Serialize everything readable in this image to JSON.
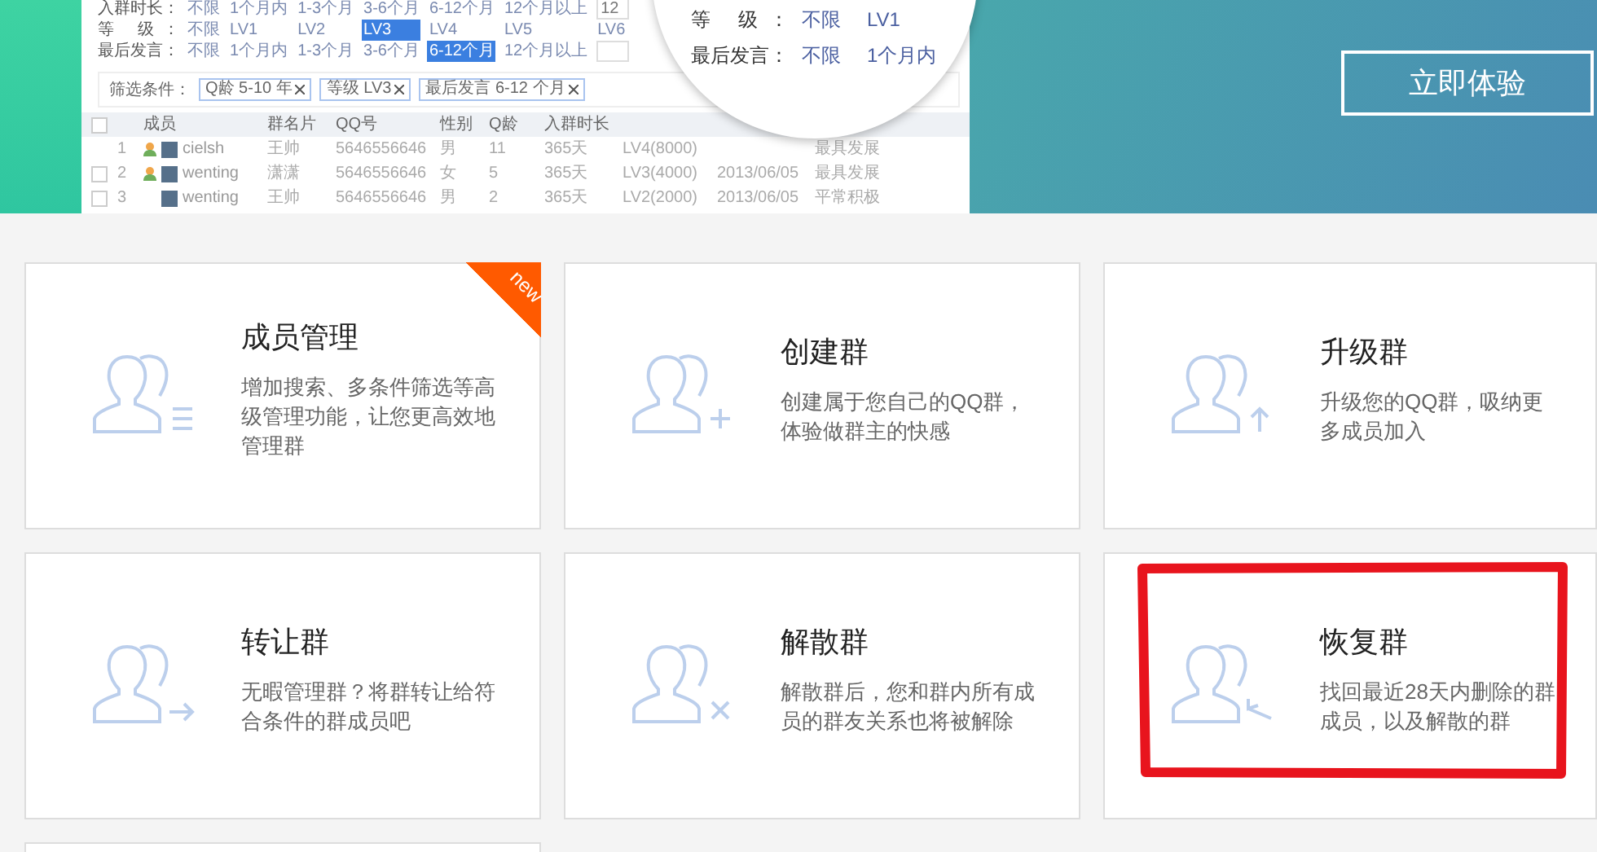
{
  "banner": {
    "preview": {
      "filters": [
        {
          "label": "入群时长：",
          "options": [
            {
              "text": "不限",
              "selected": false
            },
            {
              "text": "1个月内",
              "selected": false
            },
            {
              "text": "1-3个月",
              "selected": false
            },
            {
              "text": "3-6个月",
              "selected": false
            },
            {
              "text": "6-12个月",
              "selected": false
            },
            {
              "text": "12个月以上",
              "selected": false
            }
          ],
          "input_box": true,
          "input": "12"
        },
        {
          "label": "等 级：",
          "options": [
            {
              "text": "不限",
              "selected": false
            },
            {
              "text": "LV1",
              "selected": false
            },
            {
              "text": "LV2",
              "selected": false
            },
            {
              "text": "LV3",
              "selected": true
            },
            {
              "text": "LV4",
              "selected": false
            },
            {
              "text": "LV5",
              "selected": false
            },
            {
              "text": "LV6",
              "selected": false
            }
          ],
          "input_box": false
        },
        {
          "label": "最后发言：",
          "options": [
            {
              "text": "不限",
              "selected": false
            },
            {
              "text": "1个月内",
              "selected": false
            },
            {
              "text": "1-3个月",
              "selected": false
            },
            {
              "text": "3-6个月",
              "selected": false
            },
            {
              "text": "6-12个月",
              "selected": true
            },
            {
              "text": "12个月以上",
              "selected": false
            }
          ],
          "input_box": true
        }
      ],
      "conditions": {
        "label": "筛选条件：",
        "tags": [
          "Q龄 5-10 年",
          "等级 LV3",
          "最后发言 6-12 个月"
        ]
      },
      "table": {
        "all_checked": false,
        "columns": [
          "成员",
          "群名片",
          "QQ号",
          "性别",
          "Q龄",
          "入群时长"
        ],
        "rows": [
          {
            "index": "1",
            "admin": true,
            "name": "cielsh",
            "card": "王帅",
            "qq": "5646556646",
            "gender": "男",
            "age": "11",
            "duration": "365天",
            "level": "LV4(8000)",
            "activity": "最具发展"
          },
          {
            "checked": false,
            "index": "2",
            "admin": true,
            "name": "wenting",
            "card": "潇潇",
            "qq": "5646556646",
            "gender": "女",
            "age": "5",
            "duration": "365天",
            "level": "LV3(4000)",
            "date": "2013/06/05",
            "activity": "最具发展"
          },
          {
            "checked": false,
            "index": "3",
            "admin": false,
            "name": "wenting",
            "card": "王帅",
            "qq": "5646556646",
            "gender": "男",
            "age": "2",
            "duration": "365天",
            "level": "LV2(2000)",
            "date": "2013/06/05",
            "activity": "平常积极"
          }
        ]
      }
    },
    "magnifier": [
      {
        "label": "等 级：",
        "values": [
          "不限",
          "LV1"
        ]
      },
      {
        "label": "最后发言：",
        "values": [
          "不限",
          "1个月内"
        ]
      }
    ],
    "cta": "立即体验"
  },
  "cards": [
    {
      "title": "成员管理",
      "description": "增加搜索、多条件筛选等高级管理功能，让您更高效地管理群",
      "badge": "new",
      "highlighted": false
    },
    {
      "title": "创建群",
      "description": "创建属于您自己的QQ群，体验做群主的快感",
      "highlighted": false
    },
    {
      "title": "升级群",
      "description": "升级您的QQ群，吸纳更多成员加入",
      "highlighted": false
    },
    {
      "title": "转让群",
      "description": "无暇管理群？将群转让给符合条件的群成员吧",
      "highlighted": false
    },
    {
      "title": "解散群",
      "description": "解散群后，您和群内所有成员的群友关系也将被解除",
      "highlighted": false
    },
    {
      "title": "恢复群",
      "description": "找回最近28天内删除的群成员，以及解散的群",
      "highlighted": true
    }
  ]
}
